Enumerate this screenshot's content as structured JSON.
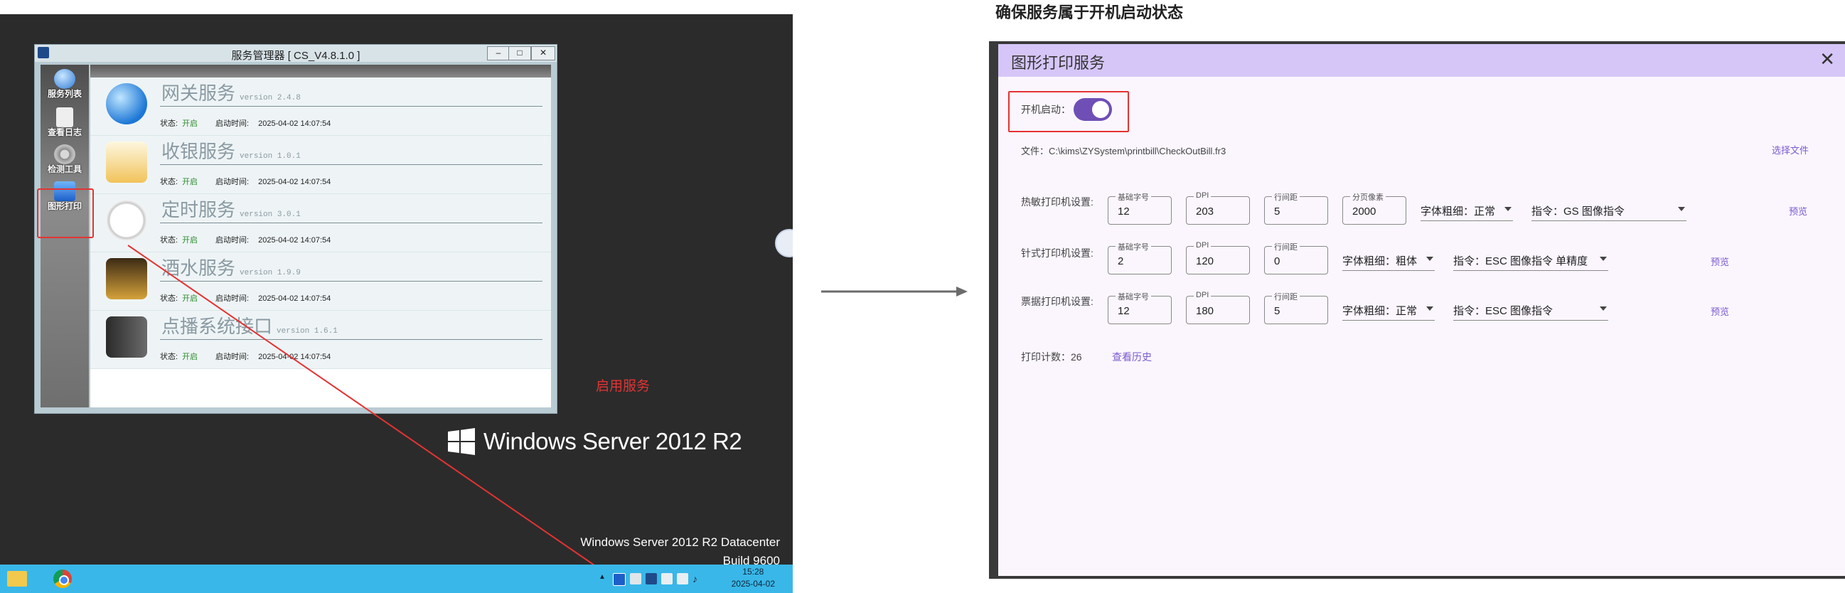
{
  "desktop": {
    "brand": "Windows Server 2012 R2",
    "edition_line1": "Windows Server 2012 R2 Datacenter",
    "edition_line2": "Build 9600",
    "clock_time": "15:28",
    "clock_date": "2025-04-02",
    "annotation_label": "启用服务"
  },
  "service_manager": {
    "title": "服务管理器 [ CS_V4.8.1.0 ]",
    "sidebar": [
      {
        "label": "服务列表"
      },
      {
        "label": "查看日志"
      },
      {
        "label": "检测工具"
      },
      {
        "label": "图形打印"
      }
    ],
    "services": [
      {
        "name": "网关服务",
        "version": "version 2.4.8",
        "status_label": "状态:",
        "status": "开启",
        "start_label": "启动时间:",
        "start_time": "2025-04-02 14:07:54"
      },
      {
        "name": "收银服务",
        "version": "version 1.0.1",
        "status_label": "状态:",
        "status": "开启",
        "start_label": "启动时间:",
        "start_time": "2025-04-02 14:07:54"
      },
      {
        "name": "定时服务",
        "version": "version 3.0.1",
        "status_label": "状态:",
        "status": "开启",
        "start_label": "启动时间:",
        "start_time": "2025-04-02 14:07:54"
      },
      {
        "name": "酒水服务",
        "version": "version 1.9.9",
        "status_label": "状态:",
        "status": "开启",
        "start_label": "启动时间:",
        "start_time": "2025-04-02 14:07:54"
      },
      {
        "name": "点播系统接口",
        "version": "version 1.6.1",
        "status_label": "状态:",
        "status": "开启",
        "start_label": "启动时间:",
        "start_time": "2025-04-02 14:07:54"
      }
    ]
  },
  "right": {
    "caption": "确保服务属于开机启动状态",
    "dialog_title": "图形打印服务",
    "autostart_label": "开机启动：",
    "autostart_on": true,
    "file_label": "文件：C:\\kims\\ZYSystem\\printbill\\CheckOutBill.fr3",
    "choose_file": "选择文件",
    "thermal": {
      "label": "热敏打印机设置:",
      "base_font_label": "基础字号",
      "base_font": "12",
      "dpi_label": "DPI",
      "dpi": "203",
      "line_label": "行间距",
      "line": "5",
      "page_label": "分页像素",
      "page": "2000",
      "weight": "字体粗细：正常",
      "cmd": "指令：GS 图像指令",
      "preview": "预览"
    },
    "needle": {
      "label": "针式打印机设置:",
      "base_font_label": "基础字号",
      "base_font": "2",
      "dpi_label": "DPI",
      "dpi": "120",
      "line_label": "行间距",
      "line": "0",
      "weight": "字体粗细：粗体",
      "cmd": "指令：ESC 图像指令 单精度",
      "preview": "预览"
    },
    "ticket": {
      "label": "票据打印机设置:",
      "base_font_label": "基础字号",
      "base_font": "12",
      "dpi_label": "DPI",
      "dpi": "180",
      "line_label": "行间距",
      "line": "5",
      "weight": "字体粗细：正常",
      "cmd": "指令：ESC 图像指令",
      "preview": "预览"
    },
    "print_count": "打印计数：26",
    "view_history": "查看历史"
  },
  "colors": {
    "accent": "#6f4fb5",
    "annotation": "#e53333",
    "dialog_header": "#d6c6f8",
    "taskbar": "#39b7e8"
  }
}
